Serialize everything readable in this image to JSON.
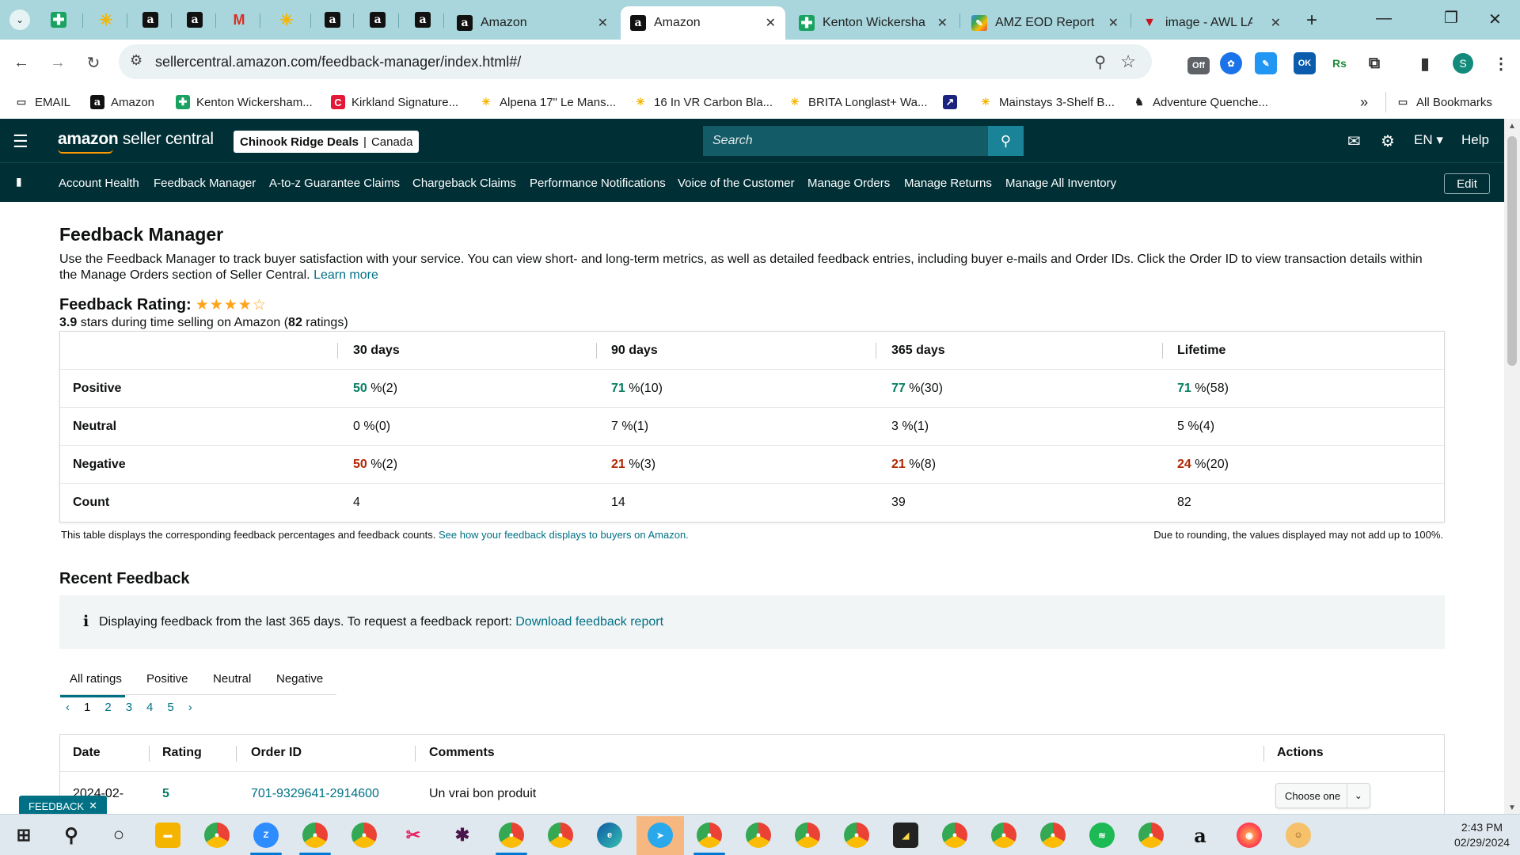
{
  "browser": {
    "tabs": [
      {
        "label": "Amazon",
        "active": false
      },
      {
        "label": "Amazon",
        "active": true
      },
      {
        "label": "Kenton Wickershan",
        "active": false
      },
      {
        "label": "AMZ EOD Report",
        "active": false
      },
      {
        "label": "image - AWL LABEL",
        "active": false
      }
    ],
    "url": "sellercentral.amazon.com/feedback-manager/index.html#/",
    "bookmarks": [
      "EMAIL",
      "Amazon",
      "Kenton Wickersham...",
      "Kirkland Signature...",
      "Alpena 17\" Le Mans...",
      "16 In VR Carbon Bla...",
      "BRITA Longlast+ Wa...",
      "Mainstays 3-Shelf B...",
      "Adventure Quenche...",
      "All Bookmarks"
    ],
    "extension_badges": {
      "off": "Off",
      "ok": "OK",
      "rs": "Rs"
    },
    "profile_initial": "S"
  },
  "header": {
    "logo_bold": "amazon",
    "logo_rest": " seller central",
    "store_name": "Chinook Ridge Deals",
    "store_separator": "|",
    "store_region": "Canada",
    "search_placeholder": "Search",
    "language": "EN ▾",
    "help": "Help"
  },
  "nav": {
    "items": [
      "Account Health",
      "Feedback Manager",
      "A-to-z Guarantee Claims",
      "Chargeback Claims",
      "Performance Notifications",
      "Voice of the Customer",
      "Manage Orders",
      "Manage Returns",
      "Manage All Inventory"
    ],
    "edit": "Edit"
  },
  "page": {
    "title": "Feedback Manager",
    "description": "Use the Feedback Manager to track buyer satisfaction with your service. You can view short- and long-term metrics, as well as detailed feedback entries, including buyer e-mails and Order IDs. Click the Order ID to view transaction details within the Manage Orders section of Seller Central.",
    "learn_more": "Learn more",
    "rating_label": "Feedback Rating:",
    "rating_stars": 4,
    "rating_stars_total": 5,
    "rating_value": "3.9",
    "rating_mid": " stars during time selling on Amazon (",
    "rating_count": "82",
    "rating_end": " ratings)"
  },
  "metrics": {
    "headers": [
      "30 days",
      "90 days",
      "365 days",
      "Lifetime"
    ],
    "rows": [
      {
        "label": "Positive",
        "color": "green",
        "cells": [
          [
            "50",
            " %(2)"
          ],
          [
            "71",
            " %(10)"
          ],
          [
            "77",
            " %(30)"
          ],
          [
            "71",
            " %(58)"
          ]
        ]
      },
      {
        "label": "Neutral",
        "color": "none",
        "cells": [
          [
            "0",
            " %(0)"
          ],
          [
            "7",
            " %(1)"
          ],
          [
            "3",
            " %(1)"
          ],
          [
            "5",
            " %(4)"
          ]
        ]
      },
      {
        "label": "Negative",
        "color": "red",
        "cells": [
          [
            "50",
            " %(2)"
          ],
          [
            "21",
            " %(3)"
          ],
          [
            "21",
            " %(8)"
          ],
          [
            "24",
            " %(20)"
          ]
        ]
      },
      {
        "label": "Count",
        "color": "none",
        "cells": [
          [
            "4",
            ""
          ],
          [
            "14",
            ""
          ],
          [
            "39",
            ""
          ],
          [
            "82",
            ""
          ]
        ]
      }
    ],
    "note_left": "This table displays the corresponding feedback percentages and feedback counts.",
    "note_link": "See how your feedback displays to buyers on Amazon.",
    "note_right": "Due to rounding, the values displayed may not add up to 100%."
  },
  "recent": {
    "title": "Recent Feedback",
    "info_text": "Displaying feedback from the last 365 days. To request a feedback report:",
    "info_link": "Download feedback report",
    "filter_tabs": [
      "All ratings",
      "Positive",
      "Neutral",
      "Negative"
    ],
    "pages": [
      "1",
      "2",
      "3",
      "4",
      "5"
    ],
    "columns": [
      "Date",
      "Rating",
      "Order ID",
      "Comments",
      "Actions"
    ],
    "rows": [
      {
        "date": "2024-02-",
        "rating": "5",
        "order_id": "701-9329641-2914600",
        "comment": "Un vrai bon produit",
        "action": "Choose one"
      }
    ]
  },
  "feedback_tab": "FEEDBACK",
  "taskbar": {
    "time": "2:43 PM",
    "date": "02/29/2024"
  },
  "colors": {
    "header_bg": "#002f36",
    "link": "#007185",
    "positive": "#067d62",
    "negative": "#b12704",
    "star": "#ffa41c"
  }
}
